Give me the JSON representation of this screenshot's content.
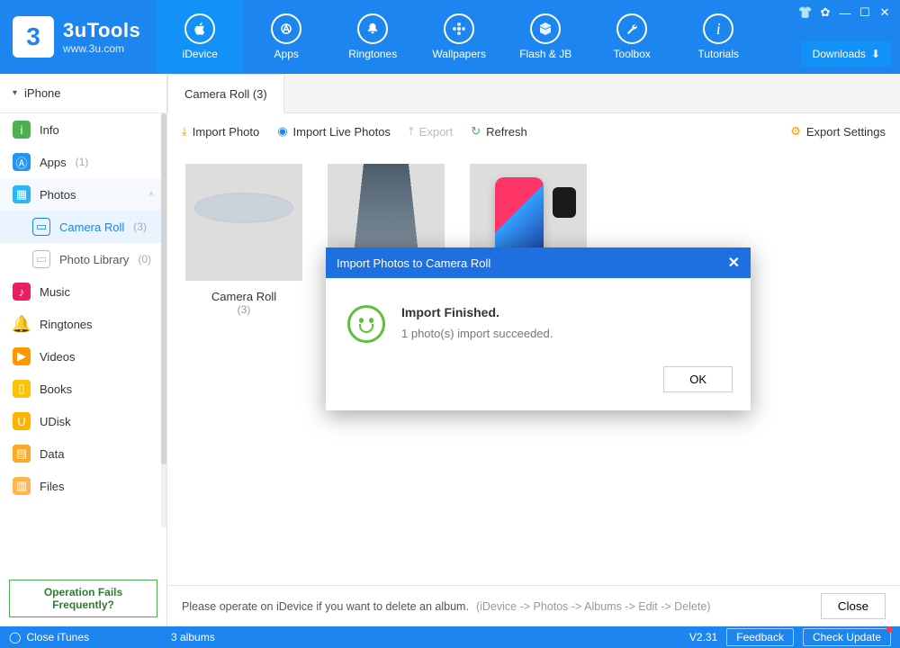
{
  "app": {
    "name": "3uTools",
    "url": "www.3u.com"
  },
  "nav": {
    "items": [
      {
        "label": "iDevice",
        "active": true
      },
      {
        "label": "Apps"
      },
      {
        "label": "Ringtones"
      },
      {
        "label": "Wallpapers"
      },
      {
        "label": "Flash & JB"
      },
      {
        "label": "Toolbox"
      },
      {
        "label": "Tutorials"
      }
    ],
    "downloads": "Downloads"
  },
  "sidebar": {
    "device": "iPhone",
    "items": [
      {
        "label": "Info"
      },
      {
        "label": "Apps",
        "count": "(1)"
      },
      {
        "label": "Photos",
        "expanded": true,
        "active": true
      },
      {
        "label": "Camera Roll",
        "count": "(3)",
        "sub": true,
        "active": true
      },
      {
        "label": "Photo Library",
        "count": "(0)",
        "sub": true
      },
      {
        "label": "Music"
      },
      {
        "label": "Ringtones"
      },
      {
        "label": "Videos"
      },
      {
        "label": "Books"
      },
      {
        "label": "UDisk"
      },
      {
        "label": "Data"
      },
      {
        "label": "Files"
      }
    ],
    "help": "Operation Fails Frequently?"
  },
  "main": {
    "tab": "Camera Roll (3)",
    "toolbar": {
      "import": "Import Photo",
      "import_live": "Import Live Photos",
      "export": "Export",
      "refresh": "Refresh",
      "export_settings": "Export Settings"
    },
    "albums": [
      {
        "name": "Camera Roll",
        "count": "(3)"
      }
    ],
    "bottom": {
      "msg": "Please operate on iDevice if you want to delete an album.",
      "hint": "(iDevice -> Photos -> Albums -> Edit -> Delete)",
      "close": "Close"
    }
  },
  "modal": {
    "title": "Import Photos to Camera Roll",
    "heading": "Import Finished.",
    "body": "1 photo(s) import succeeded.",
    "ok": "OK"
  },
  "footer": {
    "close_itunes": "Close iTunes",
    "albums": "3 albums",
    "version": "V2.31",
    "feedback": "Feedback",
    "check_update": "Check Update"
  }
}
